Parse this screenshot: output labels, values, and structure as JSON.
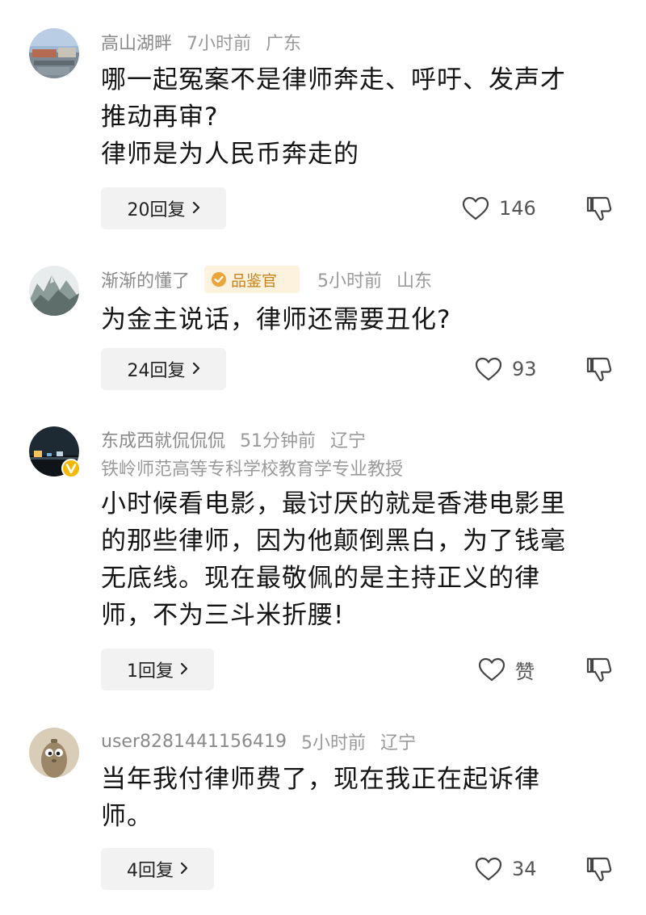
{
  "comments": [
    {
      "username": "高山湖畔",
      "time": "7小时前",
      "location": "广东",
      "lines": [
        "哪一起冤案不是律师奔走、呼吁、发声才",
        "推动再审?",
        "律师是为人民币奔走的"
      ],
      "replies": "20回复",
      "likes": "146"
    },
    {
      "username": "渐渐的懂了",
      "badge": "品鉴官",
      "time": "5小时前",
      "location": "山东",
      "lines": [
        "为金主说话，律师还需要丑化?"
      ],
      "replies": "24回复",
      "likes": "93"
    },
    {
      "username": "东成西就侃侃侃",
      "time": "51分钟前",
      "location": "辽宁",
      "title": "铁岭师范高等专科学校教育学专业教授",
      "lines": [
        "小时候看电影，最讨厌的就是香港电影里",
        "的那些律师，因为他颠倒黑白，为了钱毫",
        "无底线。现在最敬佩的是主持正义的律",
        "师，不为三斗米折腰!"
      ],
      "replies": "1回复",
      "likes": "赞"
    },
    {
      "username": "user8281441156419",
      "time": "5小时前",
      "location": "辽宁",
      "lines": [
        "当年我付律师费了，现在我正在起诉律",
        "师。"
      ],
      "replies": "4回复",
      "likes": "34"
    }
  ],
  "icons": {
    "like": "heart-outline-icon",
    "dislike": "thumbs-down-icon",
    "reply_chevron": "chevron-right-icon",
    "verified": "verified-v-icon"
  },
  "colors": {
    "text": "#141414",
    "meta": "#9a9a9a",
    "reply_bg": "#f2f2f2",
    "badge_bg": "#fdf2de",
    "badge_text": "#c7841e",
    "verified": "#f5b800"
  }
}
